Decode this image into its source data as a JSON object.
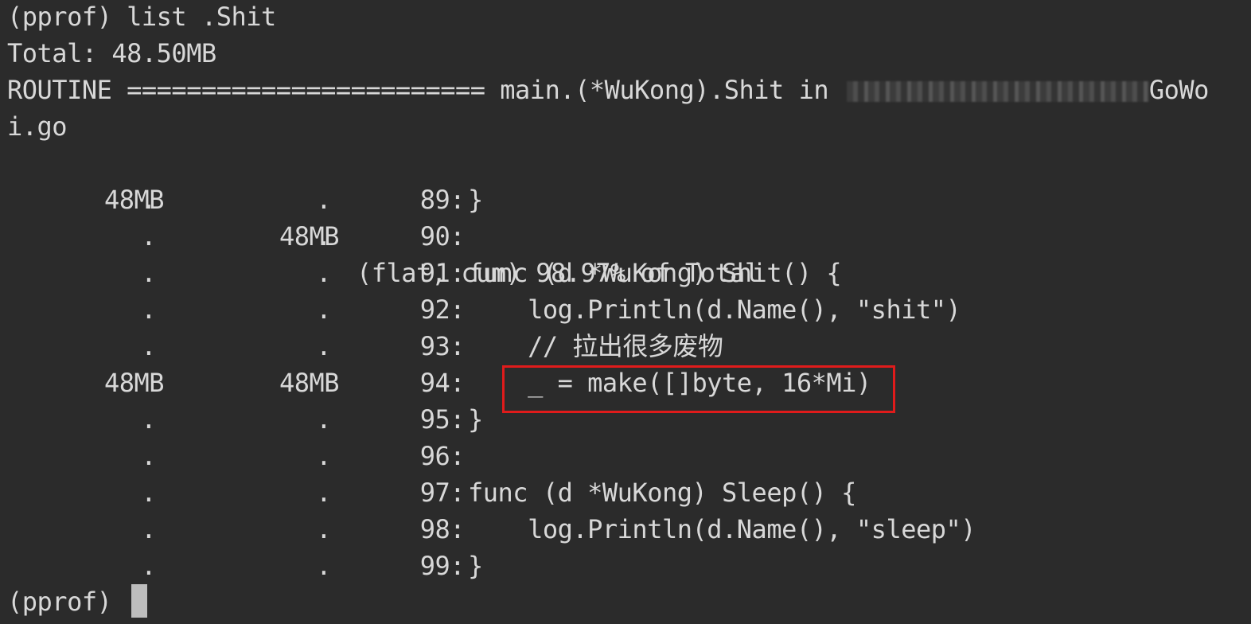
{
  "terminal": {
    "command_line": "(pprof) list .Shit",
    "total_line": "Total: 48.50MB",
    "routine_prefix": "ROUTINE ======================== main.(*WuKong).Shit in ",
    "routine_path_tail": "GoWo",
    "routine_path_wrap": "i.go",
    "summary_flat": "48MB",
    "summary_cum": "48MB",
    "summary_text": "(flat, cum) 98.97% of Total",
    "rows": [
      {
        "flat": ".",
        "cum": ".",
        "line": "89:",
        "code": "}"
      },
      {
        "flat": ".",
        "cum": ".",
        "line": "90:",
        "code": ""
      },
      {
        "flat": ".",
        "cum": ".",
        "line": "91:",
        "code": "func (d *WuKong) Shit() {"
      },
      {
        "flat": ".",
        "cum": ".",
        "line": "92:",
        "code": "    log.Println(d.Name(), \"shit\")"
      },
      {
        "flat": ".",
        "cum": ".",
        "line": "93:",
        "code": "    // 拉出很多废物"
      },
      {
        "flat": "48MB",
        "cum": "48MB",
        "line": "94:",
        "code": "    _ = make([]byte, 16*Mi)"
      },
      {
        "flat": ".",
        "cum": ".",
        "line": "95:",
        "code": "}"
      },
      {
        "flat": ".",
        "cum": ".",
        "line": "96:",
        "code": ""
      },
      {
        "flat": ".",
        "cum": ".",
        "line": "97:",
        "code": "func (d *WuKong) Sleep() {"
      },
      {
        "flat": ".",
        "cum": ".",
        "line": "98:",
        "code": "    log.Println(d.Name(), \"sleep\")"
      },
      {
        "flat": ".",
        "cum": ".",
        "line": "99:",
        "code": "}"
      }
    ],
    "prompt": "(pprof) "
  },
  "colors": {
    "background": "#2b2b2b",
    "foreground": "#d8d8d8",
    "highlight_border": "#e01b1b",
    "cursor": "#bdbdbd"
  }
}
